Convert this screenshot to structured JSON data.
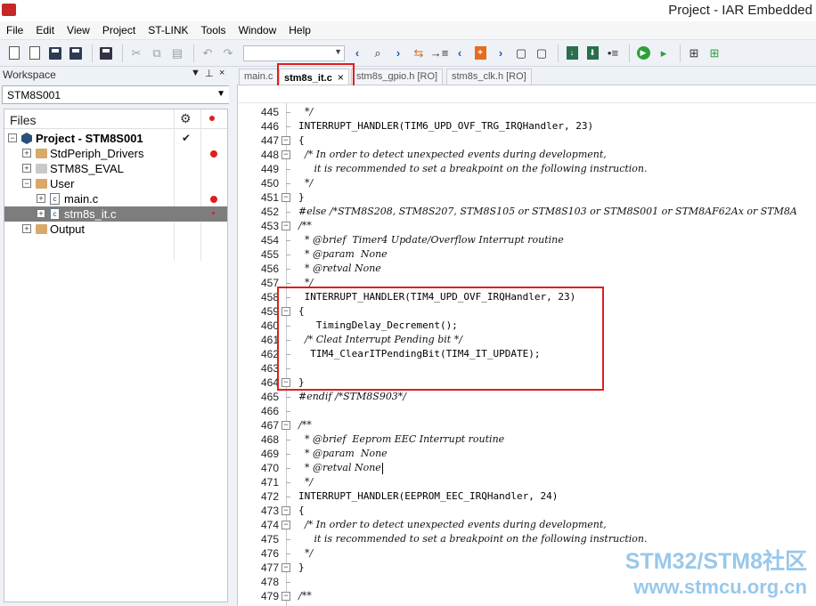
{
  "window": {
    "title": "Project - IAR Embedded"
  },
  "menu": [
    "File",
    "Edit",
    "View",
    "Project",
    "ST-LINK",
    "Tools",
    "Window",
    "Help"
  ],
  "toolbar": {
    "icons": [
      "new-file-icon",
      "open-icon",
      "save-icon",
      "save-all-icon",
      "print-icon",
      "cut-icon",
      "copy-icon",
      "paste-icon",
      "undo-icon",
      "redo-icon",
      "find-combo",
      "back-icon",
      "find-icon",
      "forward-icon",
      "find-replace-icon",
      "goto-icon",
      "prev-bookmark-icon",
      "toggle-bookmark-icon",
      "next-bookmark-icon",
      "prev-error-icon",
      "next-error-icon",
      "compile-icon",
      "make-icon",
      "stop-build-icon",
      "download-debug-icon",
      "debug-without-download-icon",
      "breakpoint-icon"
    ],
    "find_value": ""
  },
  "workspace": {
    "header": "Workspace",
    "header_controls": [
      "▼",
      "⊥",
      "×"
    ],
    "config": "STM8S001",
    "files_label": "Files",
    "tree": [
      {
        "label": "Project - STM8S001",
        "level": 0,
        "bold": true,
        "check": true,
        "type": "project",
        "expander": "−"
      },
      {
        "label": "StdPeriph_Drivers",
        "level": 1,
        "type": "folder",
        "dot": true,
        "expander": "+"
      },
      {
        "label": "STM8S_EVAL",
        "level": 1,
        "type": "folder-grey",
        "expander": "+"
      },
      {
        "label": "User",
        "level": 1,
        "type": "folder",
        "expander": "−"
      },
      {
        "label": "main.c",
        "level": 2,
        "type": "file",
        "dot": true,
        "expander": "+"
      },
      {
        "label": "stm8s_it.c",
        "level": 2,
        "type": "file",
        "selected": true,
        "dot_small": true,
        "expander": "+"
      },
      {
        "label": "Output",
        "level": 1,
        "type": "folder",
        "expander": "+"
      }
    ]
  },
  "tabs": [
    {
      "label": "main.c",
      "active": false
    },
    {
      "label": "stm8s_it.c",
      "active": true,
      "close": "×"
    },
    {
      "label": "stm8s_gpio.h [RO]",
      "active": false
    },
    {
      "label": "stm8s_clk.h [RO]",
      "active": false
    }
  ],
  "code": [
    {
      "n": "445",
      "t": "  */",
      "c": true
    },
    {
      "n": "446",
      "t": "INTERRUPT_HANDLER(TIM6_UPD_OVF_TRG_IRQHandler, 23)"
    },
    {
      "n": "447",
      "t": "{",
      "fold": "−"
    },
    {
      "n": "448",
      "t": "  /* In order to detect unexpected events during development,",
      "c": true,
      "fold": "−"
    },
    {
      "n": "449",
      "t": "     it is recommended to set a breakpoint on the following instruction.",
      "c": true
    },
    {
      "n": "450",
      "t": "  */",
      "c": true
    },
    {
      "n": "451",
      "t": "}",
      "fold": "−"
    },
    {
      "n": "452",
      "t": "#else /*STM8S208, STM8S207, STM8S105 or STM8S103 or STM8S001 or STM8AF62Ax or STM8A",
      "c": true,
      "mixed": true
    },
    {
      "n": "453",
      "t": "/**",
      "c": true,
      "fold": "−"
    },
    {
      "n": "454",
      "t": "  * @brief  Timer4 Update/Overflow Interrupt routine",
      "c": true
    },
    {
      "n": "455",
      "t": "  * @param  None",
      "c": true
    },
    {
      "n": "456",
      "t": "  * @retval None",
      "c": true
    },
    {
      "n": "457",
      "t": "  */",
      "c": true
    },
    {
      "n": "458",
      "t": " INTERRUPT_HANDLER(TIM4_UPD_OVF_IRQHandler, 23)"
    },
    {
      "n": "459",
      "t": "{",
      "fold": "−"
    },
    {
      "n": "460",
      "t": "   TimingDelay_Decrement();"
    },
    {
      "n": "461",
      "t": "  /* Cleat Interrupt Pending bit */",
      "c": true
    },
    {
      "n": "462",
      "t": "  TIM4_ClearITPendingBit(TIM4_IT_UPDATE);"
    },
    {
      "n": "463",
      "t": ""
    },
    {
      "n": "464",
      "t": "}",
      "fold": "−"
    },
    {
      "n": "465",
      "t": "#endif /*STM8S903*/",
      "c": true
    },
    {
      "n": "466",
      "t": ""
    },
    {
      "n": "467",
      "t": "/**",
      "c": true,
      "fold": "−"
    },
    {
      "n": "468",
      "t": "  * @brief  Eeprom EEC Interrupt routine",
      "c": true
    },
    {
      "n": "469",
      "t": "  * @param  None",
      "c": true
    },
    {
      "n": "470",
      "t": "  * @retval None",
      "c": true,
      "caret": true
    },
    {
      "n": "471",
      "t": "  */",
      "c": true
    },
    {
      "n": "472",
      "t": "INTERRUPT_HANDLER(EEPROM_EEC_IRQHandler, 24)"
    },
    {
      "n": "473",
      "t": "{",
      "fold": "−"
    },
    {
      "n": "474",
      "t": "  /* In order to detect unexpected events during development,",
      "c": true,
      "fold": "−"
    },
    {
      "n": "475",
      "t": "     it is recommended to set a breakpoint on the following instruction.",
      "c": true
    },
    {
      "n": "476",
      "t": "  */",
      "c": true
    },
    {
      "n": "477",
      "t": "}",
      "fold": "−"
    },
    {
      "n": "478",
      "t": ""
    },
    {
      "n": "479",
      "t": "/**",
      "c": true,
      "fold": "−"
    }
  ],
  "watermark": {
    "line1": "STM32/STM8社区",
    "line2": "www.stmcu.org.cn"
  },
  "colors": {
    "highlight": "#e01e1e",
    "selection": "#7d7d7d",
    "watermark": "#8fc3e8"
  }
}
